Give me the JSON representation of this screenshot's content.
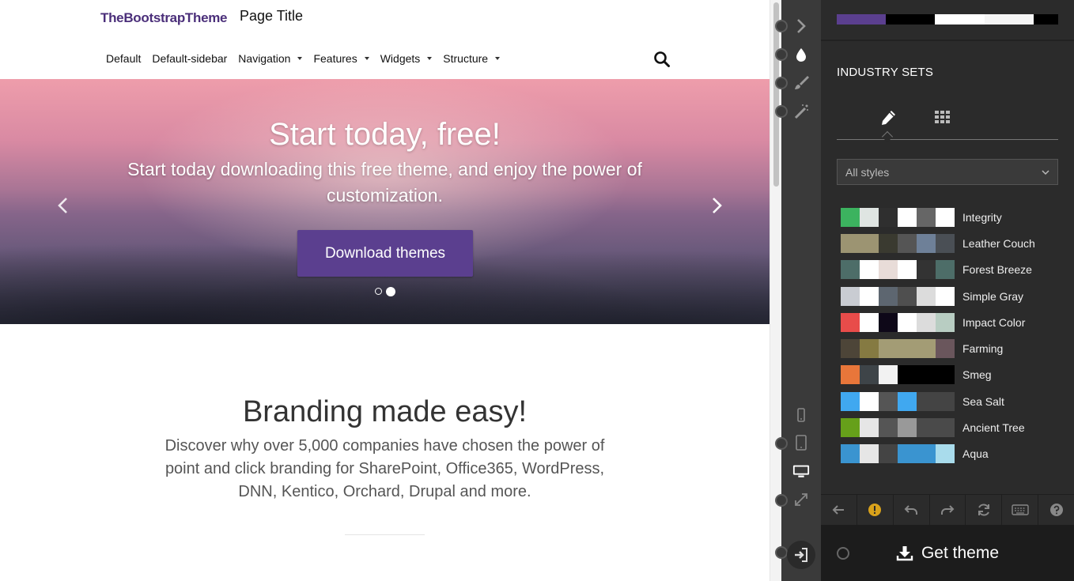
{
  "site": {
    "brand": "TheBootstrapTheme",
    "page_title": "Page Title",
    "nav": [
      {
        "label": "Default",
        "dropdown": false
      },
      {
        "label": "Default-sidebar",
        "dropdown": false
      },
      {
        "label": "Navigation",
        "dropdown": true
      },
      {
        "label": "Features",
        "dropdown": true
      },
      {
        "label": "Widgets",
        "dropdown": true
      },
      {
        "label": "Structure",
        "dropdown": true
      }
    ],
    "hero": {
      "title": "Start today, free!",
      "subtitle": "Start today downloading this free theme, and enjoy the power of customization.",
      "button": "Download themes",
      "slides": 2,
      "active_slide": 2
    },
    "branding": {
      "title": "Branding made easy!",
      "description": "Discover why over 5,000 companies have chosen the power of point and click branding for SharePoint, Office365, WordPress, DNN, Kentico, Orchard, Drupal and more."
    }
  },
  "toolbar": {
    "icons": [
      "chevron-right-icon",
      "droplet-icon",
      "brush-icon",
      "magic-wand-icon",
      "phone-icon",
      "tablet-icon",
      "desktop-icon",
      "expand-icon",
      "sign-in-icon"
    ]
  },
  "panel": {
    "current_swatch": [
      "#5b3f8f",
      "#000000",
      "#ffffff",
      "#f5f5f5",
      "#000000"
    ],
    "heading": "INDUSTRY SETS",
    "tabs": [
      "pencil-icon",
      "grid-icon"
    ],
    "filter": {
      "value": "All styles"
    },
    "palettes": [
      {
        "name": "Integrity",
        "colors": [
          "#3cb35f",
          "#dfe5e2",
          "#2f2f2f",
          "#ffffff",
          "#666666",
          "#ffffff"
        ]
      },
      {
        "name": "Leather Couch",
        "colors": [
          "#9c9472",
          "#9c9472",
          "#3a3a30",
          "#555555",
          "#6e8098",
          "#4a4f55"
        ]
      },
      {
        "name": "Forest Breeze",
        "colors": [
          "#4d6d68",
          "#ffffff",
          "#e8dcd8",
          "#ffffff",
          "#333333",
          "#4d6d68"
        ]
      },
      {
        "name": "Simple Gray",
        "colors": [
          "#c9ccd2",
          "#ffffff",
          "#5d6670",
          "#4f4f4f",
          "#dcdcdc",
          "#ffffff"
        ]
      },
      {
        "name": "Impact Color",
        "colors": [
          "#e84c4a",
          "#ffffff",
          "#0e0818",
          "#ffffff",
          "#dcdcdc",
          "#b8cdc2"
        ]
      },
      {
        "name": "Farming",
        "colors": [
          "#4d4538",
          "#857a42",
          "#a39c75",
          "#a39c75",
          "#a39c75",
          "#6a565c"
        ]
      },
      {
        "name": "Smeg",
        "colors": [
          "#e8763a",
          "#3e4448",
          "#f2f2f2",
          "#000000",
          "#000000",
          "#000000"
        ]
      },
      {
        "name": "Sea Salt",
        "colors": [
          "#40a8f0",
          "#ffffff",
          "#555555",
          "#40a8f0",
          "#444444",
          "#444444"
        ]
      },
      {
        "name": "Ancient Tree",
        "colors": [
          "#66a01a",
          "#e6e6e6",
          "#555555",
          "#999999",
          "#4a4a4a",
          "#4a4a4a"
        ]
      },
      {
        "name": "Aqua",
        "colors": [
          "#3a94d0",
          "#e6e6e6",
          "#444444",
          "#3a94d0",
          "#3a94d0",
          "#a9dcec"
        ]
      }
    ],
    "bottom_toolbar": [
      "arrow-left-icon",
      "warning-icon",
      "undo-icon",
      "redo-icon",
      "refresh-icon",
      "keyboard-icon",
      "help-icon"
    ],
    "get_theme": "Get theme"
  }
}
